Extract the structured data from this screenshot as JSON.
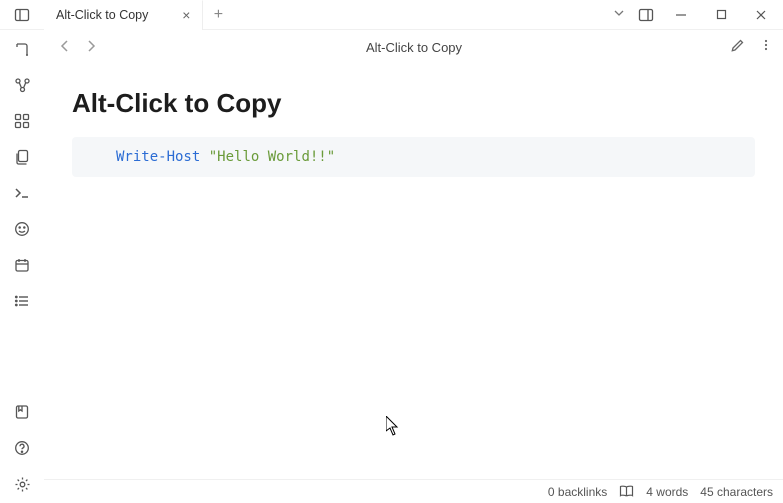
{
  "tab": {
    "title": "Alt-Click to Copy"
  },
  "header": {
    "title": "Alt-Click to Copy"
  },
  "document": {
    "title": "Alt-Click to Copy",
    "code": {
      "fn": "Write-Host",
      "str": "\"Hello World!!\""
    }
  },
  "status": {
    "backlinks": "0 backlinks",
    "words": "4 words",
    "characters": "45 characters"
  }
}
